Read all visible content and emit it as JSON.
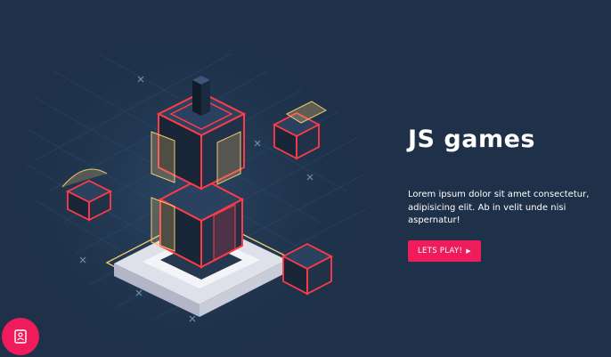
{
  "hero": {
    "title": "JS games",
    "description": "Lorem ipsum dolor sit amet consectetur, adipisicing elit. Ab in velit unde nisi aspernatur!",
    "cta_label": "LETS PLAY!",
    "cta_icon": "play-triangle-icon"
  },
  "fab": {
    "icon": "contact-card-icon"
  },
  "colors": {
    "background": "#1e3149",
    "accent": "#ee1c5b",
    "neon_red": "#ff3b48",
    "neon_yellow": "#f3c86a",
    "cube_dark": "#1a2b40"
  }
}
